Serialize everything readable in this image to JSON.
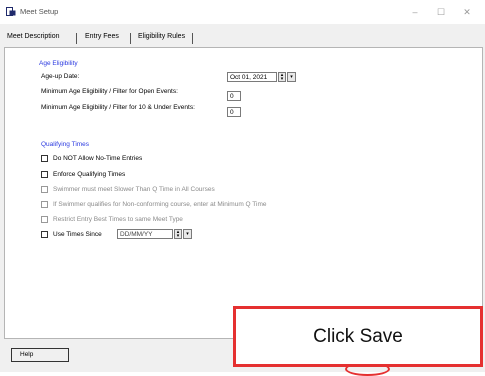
{
  "window": {
    "title": "Meet Setup",
    "controls": {
      "minimize": "–",
      "maximize": "☐",
      "close": "✕"
    }
  },
  "tabs": [
    {
      "label": "Meet Description",
      "active": true
    },
    {
      "label": "Entry Fees",
      "active": false
    },
    {
      "label": "Eligibility Rules",
      "active": false
    }
  ],
  "age_eligibility": {
    "heading": "Age Eligibility",
    "age_up_label": "Age-up Date:",
    "age_up_value": "Oct 01, 2021",
    "min_open_label": "Minimum Age Eligibility / Filter for Open Events:",
    "min_open_value": "0",
    "min_10u_label": "Minimum Age Eligibility / Filter for 10 & Under Events:",
    "min_10u_value": "0"
  },
  "qualifying_times": {
    "heading": "Qualifying Times",
    "options": [
      {
        "label": "Do NOT Allow No-Time Entries",
        "checked": false,
        "enabled": true
      },
      {
        "label": "Enforce Qualifying Times",
        "checked": false,
        "enabled": true
      },
      {
        "label": "Swimmer must meet Slower Than Q Time in All Courses",
        "checked": false,
        "enabled": false
      },
      {
        "label": "If Swimmer qualifies for Non-conforming course, enter at Minimum Q Time",
        "checked": false,
        "enabled": false
      },
      {
        "label": "Restrict Entry Best Times to same Meet Type",
        "checked": false,
        "enabled": false
      }
    ],
    "use_times_since_label": "Use Times Since",
    "use_times_since_value": "DD/MM/YY"
  },
  "footer": {
    "help_label": "Help"
  },
  "callout": {
    "text": "Click Save"
  },
  "colors": {
    "heading": "#2b3ae0",
    "callout_border": "#e53030"
  }
}
